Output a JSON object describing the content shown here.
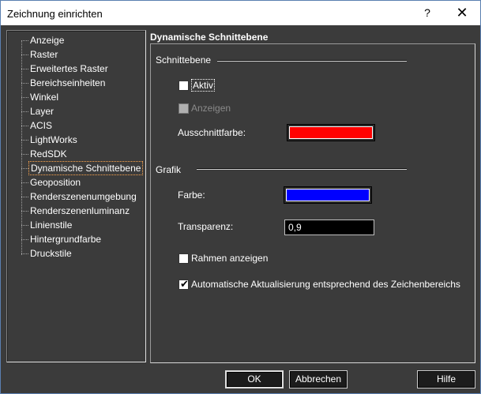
{
  "window": {
    "title": "Zeichnung einrichten",
    "help_glyph": "?",
    "close_glyph": "✕"
  },
  "tree": {
    "items": [
      {
        "label": "Anzeige"
      },
      {
        "label": "Raster"
      },
      {
        "label": "Erweitertes Raster"
      },
      {
        "label": "Bereichseinheiten"
      },
      {
        "label": "Winkel"
      },
      {
        "label": "Layer"
      },
      {
        "label": "ACIS"
      },
      {
        "label": "LightWorks"
      },
      {
        "label": "RedSDK"
      },
      {
        "label": "Dynamische Schnittebene"
      },
      {
        "label": "Geoposition"
      },
      {
        "label": "Renderszenenumgebung"
      },
      {
        "label": "Renderszenenluminanz"
      },
      {
        "label": "Linienstile"
      },
      {
        "label": "Hintergrundfarbe"
      },
      {
        "label": "Druckstile"
      }
    ],
    "selected": "Dynamische Schnittebene"
  },
  "panel": {
    "header": "Dynamische Schnittebene",
    "schnittebene": {
      "section_label": "Schnittebene",
      "aktiv_label": "Aktiv",
      "aktiv_checked": false,
      "anzeigen_label": "Anzeigen",
      "anzeigen_checked": false,
      "anzeigen_enabled": false,
      "ausschnittfarbe_label": "Ausschnittfarbe:",
      "ausschnittfarbe_color": "#ff0000"
    },
    "grafik": {
      "section_label": "Grafik",
      "farbe_label": "Farbe:",
      "farbe_color": "#0000ff",
      "transparenz_label": "Transparenz:",
      "transparenz_value": "0,9",
      "rahmen_label": "Rahmen anzeigen",
      "rahmen_checked": false,
      "auto_update_label": "Automatische Aktualisierung entsprechend des Zeichenbereichs",
      "auto_update_checked": true
    }
  },
  "buttons": {
    "ok": "OK",
    "cancel": "Abbrechen",
    "help": "Hilfe"
  },
  "check_glyph": "✔"
}
